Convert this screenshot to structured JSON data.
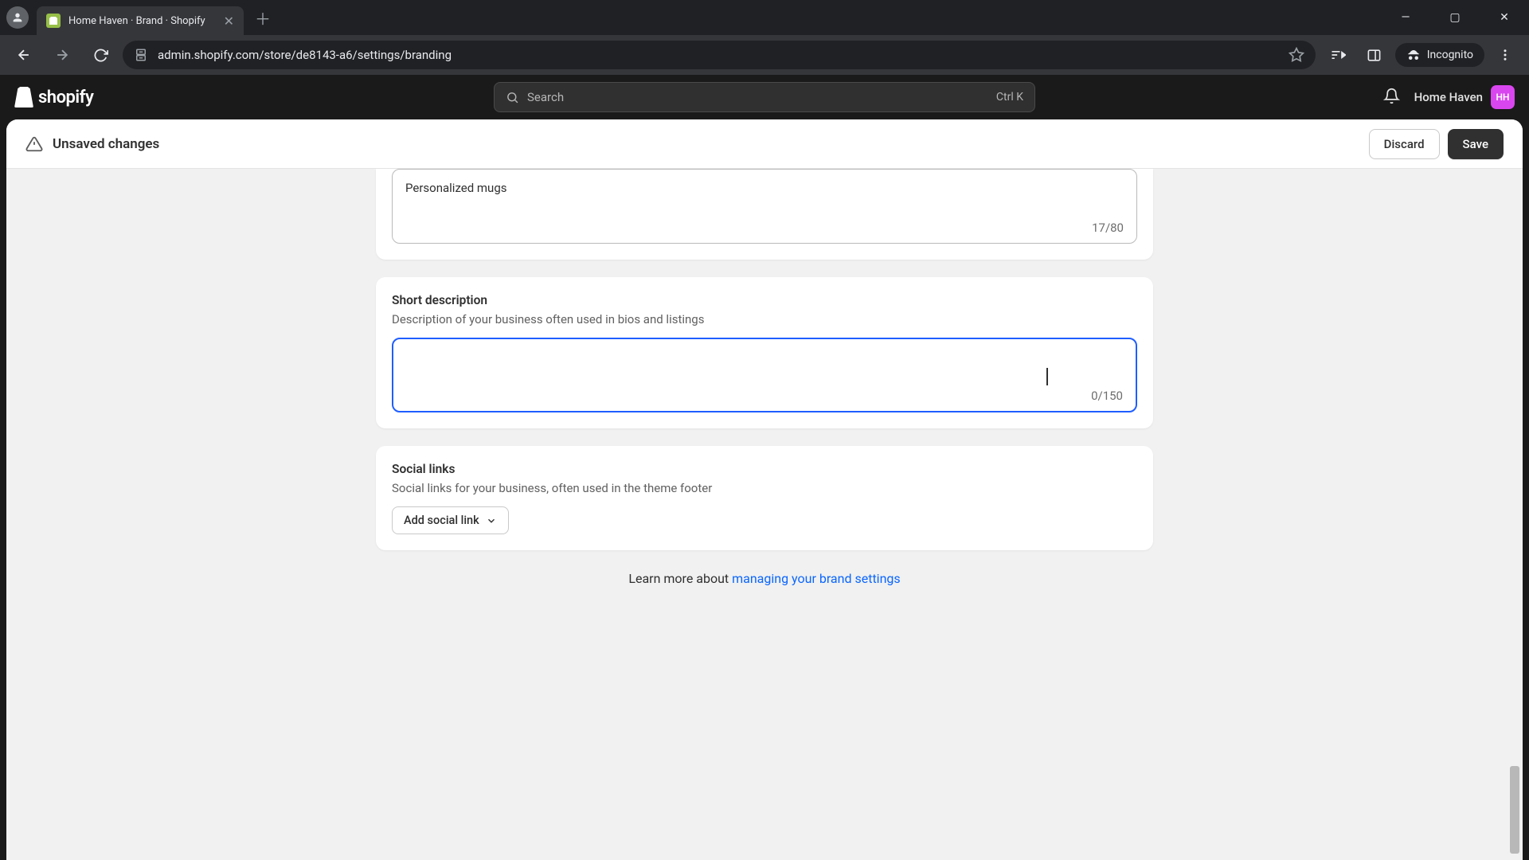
{
  "browser": {
    "tab_title": "Home Haven · Brand · Shopify",
    "url": "admin.shopify.com/store/de8143-a6/settings/branding",
    "incognito_label": "Incognito"
  },
  "header": {
    "brand": "shopify",
    "search_placeholder": "Search",
    "search_shortcut": "Ctrl K",
    "store_name": "Home Haven",
    "store_initials": "HH"
  },
  "savebar": {
    "message": "Unsaved changes",
    "discard": "Discard",
    "save": "Save"
  },
  "slogan": {
    "value": "Personalized mugs",
    "counter": "17/80"
  },
  "short_description": {
    "title": "Short description",
    "subtitle": "Description of your business often used in bios and listings",
    "value": "",
    "counter": "0/150"
  },
  "social": {
    "title": "Social links",
    "subtitle": "Social links for your business, often used in the theme footer",
    "add_label": "Add social link"
  },
  "footer": {
    "prefix": "Learn more about ",
    "link": "managing your brand settings"
  }
}
